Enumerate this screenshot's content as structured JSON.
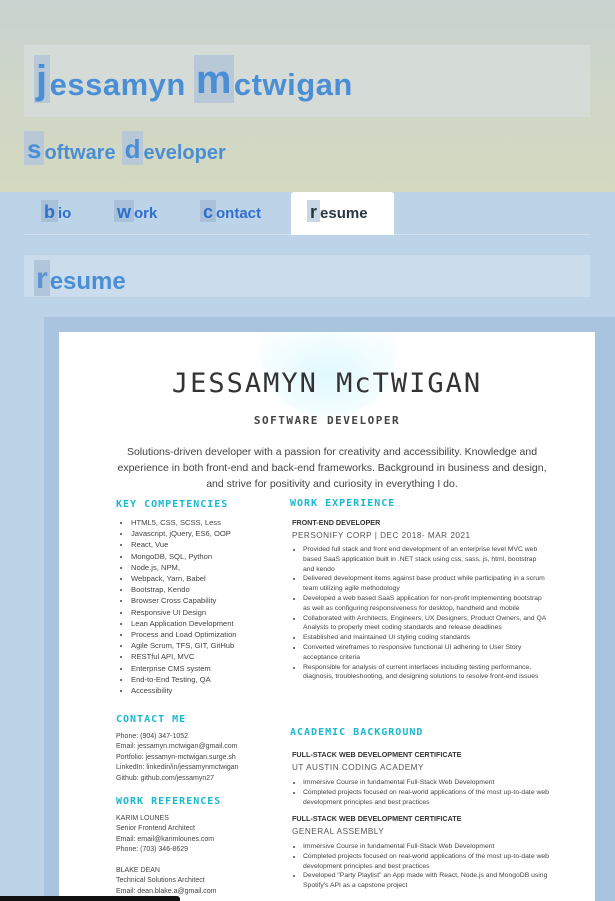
{
  "header": {
    "first_initial": "j",
    "first_rest": "essamyn",
    "last_initial": "m",
    "last_rest": "ctwigan",
    "title_word1_initial": "s",
    "title_word1_rest": "oftware",
    "title_word2_initial": "d",
    "title_word2_rest": "eveloper"
  },
  "nav": {
    "tabs": [
      {
        "initial": "b",
        "rest": "io"
      },
      {
        "initial": "w",
        "rest": "ork"
      },
      {
        "initial": "c",
        "rest": "ontact"
      },
      {
        "initial": "r",
        "rest": "esume"
      }
    ],
    "active": "resume"
  },
  "section": {
    "initial": "r",
    "rest": "esume"
  },
  "resume": {
    "name": "JESSAMYN McTWIGAN",
    "role": "SOFTWARE DEVELOPER",
    "summary": "Solutions-driven developer with a passion for creativity and accessibility. Knowledge and experience in both front-end and back-end frameworks. Background in business and design, and strive for positivity and curiosity in everything I do.",
    "competencies_heading": "KEY COMPETENCIES",
    "competencies": [
      "HTML5, CSS, SCSS, Less",
      "Javascript, jQuery, ES6, OOP",
      "React, Vue",
      "MongoDB, SQL, Python",
      "Node.js, NPM,",
      "Webpack, Yarn, Babel",
      "Bootstrap, Kendo",
      "Browser Cross Capability",
      "Responsive UI Design",
      "Lean Application Development",
      "Process and Load Optimization",
      "Agile Scrum, TFS, GIT, GitHub",
      "RESTful API, MVC",
      "Enterprise CMS system",
      "End-to-End Testing, QA",
      "Accessibility"
    ],
    "contact_heading": "CONTACT ME",
    "contact_lines": [
      "Phone: (904) 347-1052",
      "Email: jessamyn.mctwigan@gmail.com",
      "Portfolio: jessamyn-mctwigan.surge.sh",
      "LinkedIn: linkedin/in/jessamynmctwigan",
      "Github: github.com/jessamyn27"
    ],
    "references_heading": "WORK REFERENCES",
    "reference1": [
      "KARIM LOUNES",
      "Senior Frontend Architect",
      "Email: email@karimlounes.com",
      "Phone: (703) 346-8629"
    ],
    "reference2": [
      "BLAKE DEAN",
      "Technical Solutions Architect",
      "Email: dean.blake.a@gmail.com"
    ],
    "experience_heading": "WORK EXPERIENCE",
    "job_title": "FRONT-END DEVELOPER",
    "job_company": "PERSONIFY CORP | DEC 2018- MAR 2021",
    "job_bullets": [
      "Provided full stack and front end development of an enterprise level MVC web based SaaS application built in .NET stack using css, sass, js, html, bootstrap and kendo",
      "Delivered development items against base product while participating in a scrum team utilizing agile methodology",
      "Developed a web based SaaS application for non-profit implementing bootstrap as well as configuring responsiveness for desktop, handheld and mobile",
      "Collaborated with Architects, Engineers, UX Designers, Product Owners, and QA Analysts to properly meet coding standards and release deadlines",
      "Established and maintained UI styling coding standards",
      "Converted wireframes to responsive functional UI adhering to User Story acceptance criteria",
      "Responsible for analysis of current interfaces including testing performance, diagnosis, troubleshooting, and designing solutions to resolve front-end issues"
    ],
    "academic_heading": "ACADEMIC BACKGROUND",
    "cert1_title": "FULL-STACK WEB DEVELOPMENT CERTIFICATE",
    "cert1_school": "UT AUSTIN CODING ACADEMY",
    "cert1_bullets": [
      "Immersive Course in fundamental Full-Stack Web Development",
      "Completed projects focused on real-world applications of the most up-to-date web development principles and best practices"
    ],
    "cert2_title": "FULL-STACK WEB DEVELOPMENT CERTIFICATE",
    "cert2_school": "GENERAL ASSEMBLY",
    "cert2_bullets": [
      "Immersive Course in fundamental Full-Stack Web Development",
      "Completed projects focused on real-world applications of the most up-to-date web development principles and best practices",
      "Developed \"Party Playlist\" an App made with React, Node.js and MongoDB using Spotify's API as a capstone project"
    ]
  }
}
